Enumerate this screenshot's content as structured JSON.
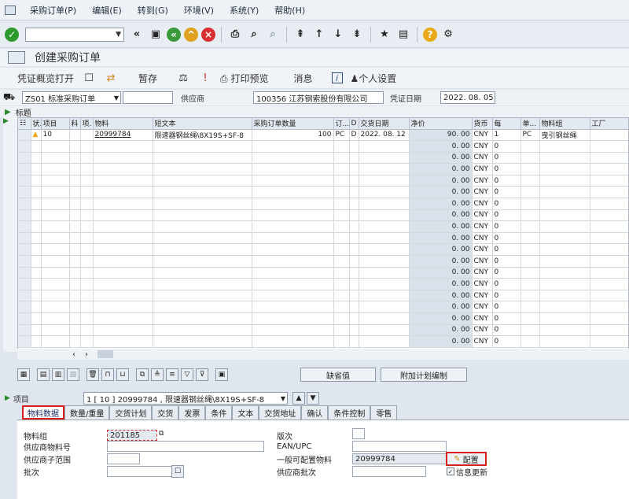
{
  "menu": [
    "采购订单(P)",
    "编辑(E)",
    "转到(G)",
    "环境(V)",
    "系统(Y)",
    "帮助(H)"
  ],
  "title": "创建采购订单",
  "app_toolbar": {
    "overview": "凭证概览打开",
    "hold": "暂存",
    "print_preview": "打印预览",
    "messages": "消息",
    "personal_settings": "个人设置"
  },
  "header": {
    "doc_type": "ZS01 标准采购订单",
    "vendor_label": "供应商",
    "vendor_value": "100356 江苏钢索股份有限公司",
    "doc_date_label": "凭证日期",
    "doc_date_value": "2022. 08. 05"
  },
  "section_header": "标题",
  "grid": {
    "columns": [
      "状.",
      "项目",
      "科",
      "项.",
      "物料",
      "短文本",
      "采购订单数量",
      "订...",
      "D",
      "交货日期",
      "净价",
      "货币",
      "每",
      "单...",
      "物料组",
      "工厂"
    ],
    "rows": [
      {
        "status": "warning",
        "item": "10",
        "material": "20999784",
        "short_text": "限速器钢丝绳\\8X19S+SF-8",
        "qty": "100",
        "unit": "PC",
        "d": "D",
        "delivery_date": "2022. 08. 12",
        "net_price": "90. 00",
        "currency": "CNY",
        "per": "1",
        "unit2": "PC",
        "mat_group": "曳引钢丝绳"
      },
      {
        "net_price": "0. 00",
        "currency": "CNY",
        "per": "0"
      },
      {
        "net_price": "0. 00",
        "currency": "CNY",
        "per": "0"
      },
      {
        "net_price": "0. 00",
        "currency": "CNY",
        "per": "0"
      },
      {
        "net_price": "0. 00",
        "currency": "CNY",
        "per": "0"
      },
      {
        "net_price": "0. 00",
        "currency": "CNY",
        "per": "0"
      },
      {
        "net_price": "0. 00",
        "currency": "CNY",
        "per": "0"
      },
      {
        "net_price": "0. 00",
        "currency": "CNY",
        "per": "0"
      },
      {
        "net_price": "0. 00",
        "currency": "CNY",
        "per": "0"
      },
      {
        "net_price": "0. 00",
        "currency": "CNY",
        "per": "0"
      },
      {
        "net_price": "0. 00",
        "currency": "CNY",
        "per": "0"
      },
      {
        "net_price": "0. 00",
        "currency": "CNY",
        "per": "0"
      },
      {
        "net_price": "0. 00",
        "currency": "CNY",
        "per": "0"
      },
      {
        "net_price": "0. 00",
        "currency": "CNY",
        "per": "0"
      },
      {
        "net_price": "0. 00",
        "currency": "CNY",
        "per": "0"
      },
      {
        "net_price": "0. 00",
        "currency": "CNY",
        "per": "0"
      },
      {
        "net_price": "0. 00",
        "currency": "CNY",
        "per": "0"
      },
      {
        "net_price": "0. 00",
        "currency": "CNY",
        "per": "0"
      },
      {
        "net_price": "0. 00",
        "currency": "CNY",
        "per": "0"
      }
    ]
  },
  "buttons": {
    "default_values": "缺省值",
    "add_plan": "附加计划编制"
  },
  "item_selector": {
    "label": "项目",
    "value": "1 [ 10 ] 20999784 , 限速器钢丝绳\\8X19S+SF-8"
  },
  "tabs": [
    "物料数据",
    "数量/重量",
    "交货计划",
    "交货",
    "发票",
    "条件",
    "文本",
    "交货地址",
    "确认",
    "条件控制",
    "零售"
  ],
  "material_data": {
    "mat_group_label": "物料组",
    "mat_group_value": "201185",
    "vendor_mat_label": "供应商物料号",
    "vendor_subrange_label": "供应商子范围",
    "batch_label": "批次",
    "version_label": "版次",
    "ean_label": "EAN/UPC",
    "config_mat_label": "一般可配置物料",
    "config_mat_value": "20999784",
    "config_button": "配置",
    "vendor_batch_label": "供应商批次",
    "info_update_label": "信息更新"
  }
}
